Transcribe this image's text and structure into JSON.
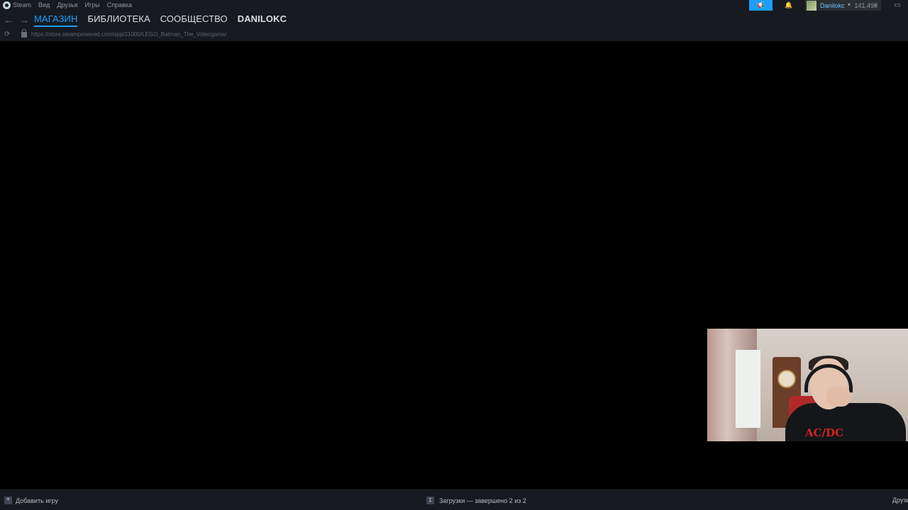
{
  "titlebar": {
    "menu": [
      "Steam",
      "Вид",
      "Друзья",
      "Игры",
      "Справка"
    ],
    "account": {
      "name": "Danilokc",
      "balance": "141,49₴"
    }
  },
  "nav": {
    "tabs": [
      "МАГАЗИН",
      "БИБЛИОТЕКА",
      "СООБЩЕСТВО",
      "DANILOKC"
    ],
    "active_tab": "МАГАЗИН",
    "url": "https://store.steampowered.com/app/21000/LEGO_Batman_The_Videogame/"
  },
  "webcam": {
    "shirt_logo": "AC/DC"
  },
  "status": {
    "add_game": "Добавить игру",
    "downloads": "Загрузки — завершено 2 из 2",
    "friends": "Друзь"
  },
  "colors": {
    "accent": "#1a9fff",
    "chrome": "#171a21",
    "username": "#67c1f5"
  }
}
